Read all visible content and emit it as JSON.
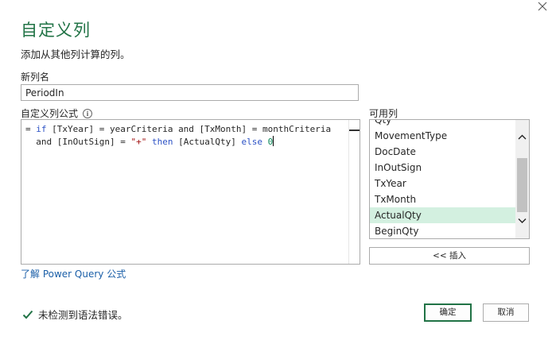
{
  "dialog": {
    "title": "自定义列",
    "subtitle": "添加从其他列计算的列。",
    "close_icon": "close-icon"
  },
  "name_field": {
    "label": "新列名",
    "value": "PeriodIn"
  },
  "formula": {
    "label": "自定义列公式",
    "info_icon": "i",
    "line1": {
      "prefix": "= ",
      "if": "if",
      "part1": " [TxYear] = yearCriteria and [TxMonth] = monthCriteria"
    },
    "line2": {
      "part1": "  and [InOutSign] = ",
      "string": "\"+\"",
      "space1": " ",
      "then": "then",
      "part2": " [ActualQty] ",
      "else": "else",
      "space2": " ",
      "zero": "0"
    }
  },
  "columns": {
    "label": "可用列",
    "items": [
      "Qty",
      "MovementType",
      "DocDate",
      "InOutSign",
      "TxYear",
      "TxMonth",
      "ActualQty",
      "BeginQty"
    ],
    "selected": "ActualQty",
    "insert_label": "<< 插入"
  },
  "learn_link": "了解 Power Query 公式",
  "status": {
    "text": "未检测到语法错误。",
    "icon": "checkmark-icon",
    "color": "#217346"
  },
  "buttons": {
    "ok": "确定",
    "cancel": "取消"
  },
  "colors": {
    "accent": "#217346",
    "keyword": "#2b51c5",
    "string": "#a31515",
    "number": "#098658",
    "selection": "#d3f0e0",
    "link": "#1b5fa8"
  }
}
